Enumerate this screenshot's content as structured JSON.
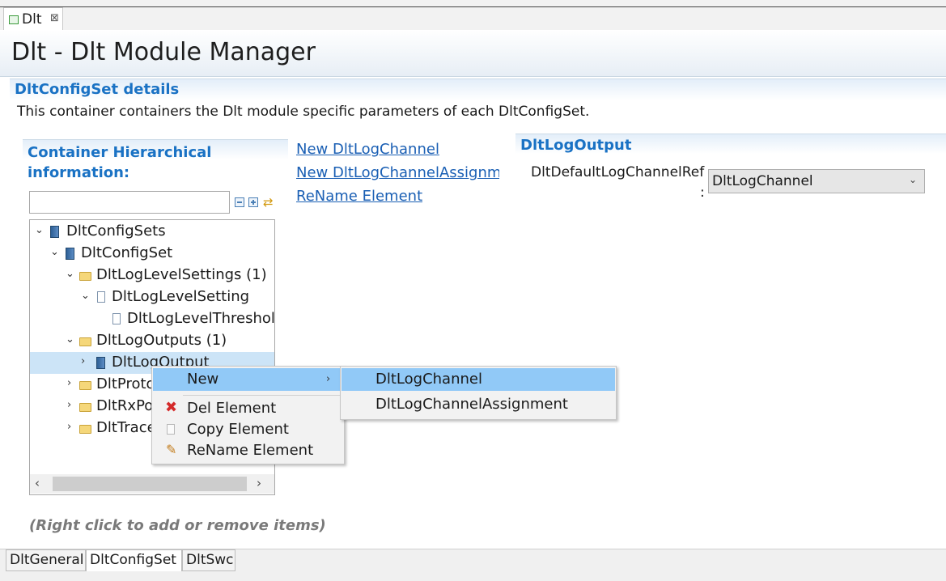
{
  "editor_tab": {
    "label": "Dlt",
    "close": "⊠"
  },
  "header": {
    "title": "Dlt - Dlt Module Manager"
  },
  "section": {
    "title": "DltConfigSet details",
    "description": "This container containers the Dlt module specific parameters of each DltConfigSet."
  },
  "left_panel": {
    "title": "Container Hierarchical information:",
    "filter_value": "",
    "hint": "(Right click to add or remove items)"
  },
  "tree": {
    "items": [
      {
        "label": "DltConfigSets",
        "icon": "config-icon",
        "expanded": true
      },
      {
        "label": "DltConfigSet",
        "icon": "config-icon",
        "expanded": true
      },
      {
        "label": "DltLogLevelSettings (1)",
        "icon": "folder-icon",
        "expanded": true
      },
      {
        "label": "DltLogLevelSetting",
        "icon": "document-icon",
        "expanded": true
      },
      {
        "label": "DltLogLevelThreshold",
        "icon": "document-icon"
      },
      {
        "label": "DltLogOutputs (1)",
        "icon": "folder-icon",
        "expanded": true
      },
      {
        "label": "DltLogOutput",
        "icon": "config-icon",
        "expanded": false,
        "selected": true
      },
      {
        "label": "DltProtocol",
        "icon": "folder-icon",
        "expanded": false
      },
      {
        "label": "DltRxPool",
        "icon": "folder-icon",
        "expanded": false
      },
      {
        "label": "DltTraceStatus",
        "icon": "folder-icon",
        "expanded": false
      }
    ]
  },
  "links": {
    "new_channel": "New DltLogChannel",
    "new_assignment": "New DltLogChannelAssignment",
    "rename": "ReName Element"
  },
  "right_panel": {
    "title": "DltLogOutput",
    "ref_label": "DltDefaultLogChannelRef",
    "ref_colon": ":",
    "ref_value": "DltLogChannel"
  },
  "context_menu": {
    "new": "New",
    "del": "Del Element",
    "copy": "Copy Element",
    "rename": "ReName Element"
  },
  "submenu": {
    "channel": "DltLogChannel",
    "assignment": "DltLogChannelAssignment"
  },
  "page_tabs": [
    "DltGeneral",
    "DltConfigSet",
    "DltSwc"
  ],
  "colors": {
    "accent": "#1a72c4",
    "selection": "#cce4f7",
    "menu_highlight": "#91c9f7"
  }
}
